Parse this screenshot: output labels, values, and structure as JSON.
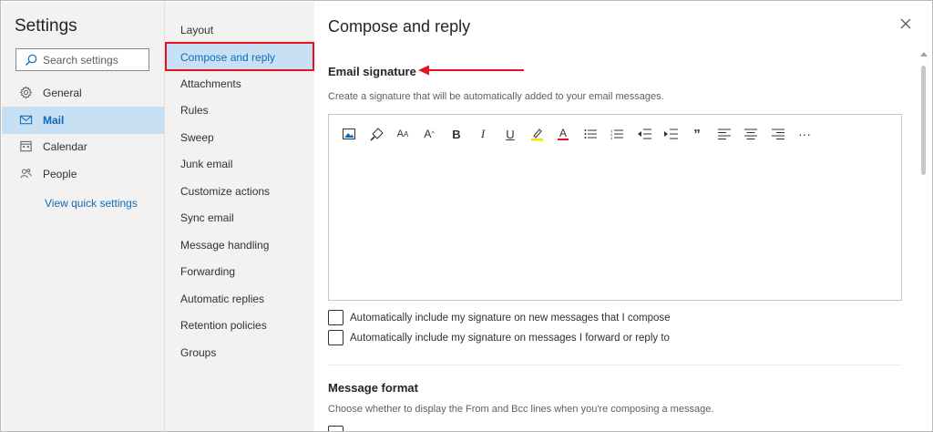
{
  "settings": {
    "title": "Settings",
    "search_placeholder": "Search settings",
    "nav": [
      {
        "label": "General",
        "icon": "gear-icon",
        "active": false
      },
      {
        "label": "Mail",
        "icon": "mail-icon",
        "active": true
      },
      {
        "label": "Calendar",
        "icon": "calendar-icon",
        "active": false
      },
      {
        "label": "People",
        "icon": "people-icon",
        "active": false
      }
    ],
    "quick_link": "View quick settings"
  },
  "categories": [
    {
      "label": "Layout"
    },
    {
      "label": "Compose and reply",
      "active": true
    },
    {
      "label": "Attachments"
    },
    {
      "label": "Rules"
    },
    {
      "label": "Sweep"
    },
    {
      "label": "Junk email"
    },
    {
      "label": "Customize actions"
    },
    {
      "label": "Sync email"
    },
    {
      "label": "Message handling"
    },
    {
      "label": "Forwarding"
    },
    {
      "label": "Automatic replies"
    },
    {
      "label": "Retention policies"
    },
    {
      "label": "Groups"
    }
  ],
  "content": {
    "title": "Compose and reply",
    "signature": {
      "heading": "Email signature",
      "description": "Create a signature that will be automatically added to your email messages.",
      "toolbar": [
        "insert-image-icon",
        "format-painter-icon",
        "font-size-decrease-icon",
        "font-size-increase-icon",
        "bold-icon",
        "italic-icon",
        "underline-icon",
        "highlight-icon",
        "font-color-icon",
        "bullets-icon",
        "numbering-icon",
        "decrease-indent-icon",
        "increase-indent-icon",
        "quote-icon",
        "align-left-icon",
        "align-center-icon",
        "align-right-icon",
        "more-options-icon"
      ],
      "check_new": "Automatically include my signature on new messages that I compose",
      "check_reply": "Automatically include my signature on messages I forward or reply to"
    },
    "format": {
      "heading": "Message format",
      "description": "Choose whether to display the From and Bcc lines when you're composing a message."
    }
  },
  "colors": {
    "accent": "#0f6cbd",
    "highlight_border": "#e81123",
    "selected_bg": "#c7e0f4",
    "pane_bg": "#f3f2f1"
  }
}
